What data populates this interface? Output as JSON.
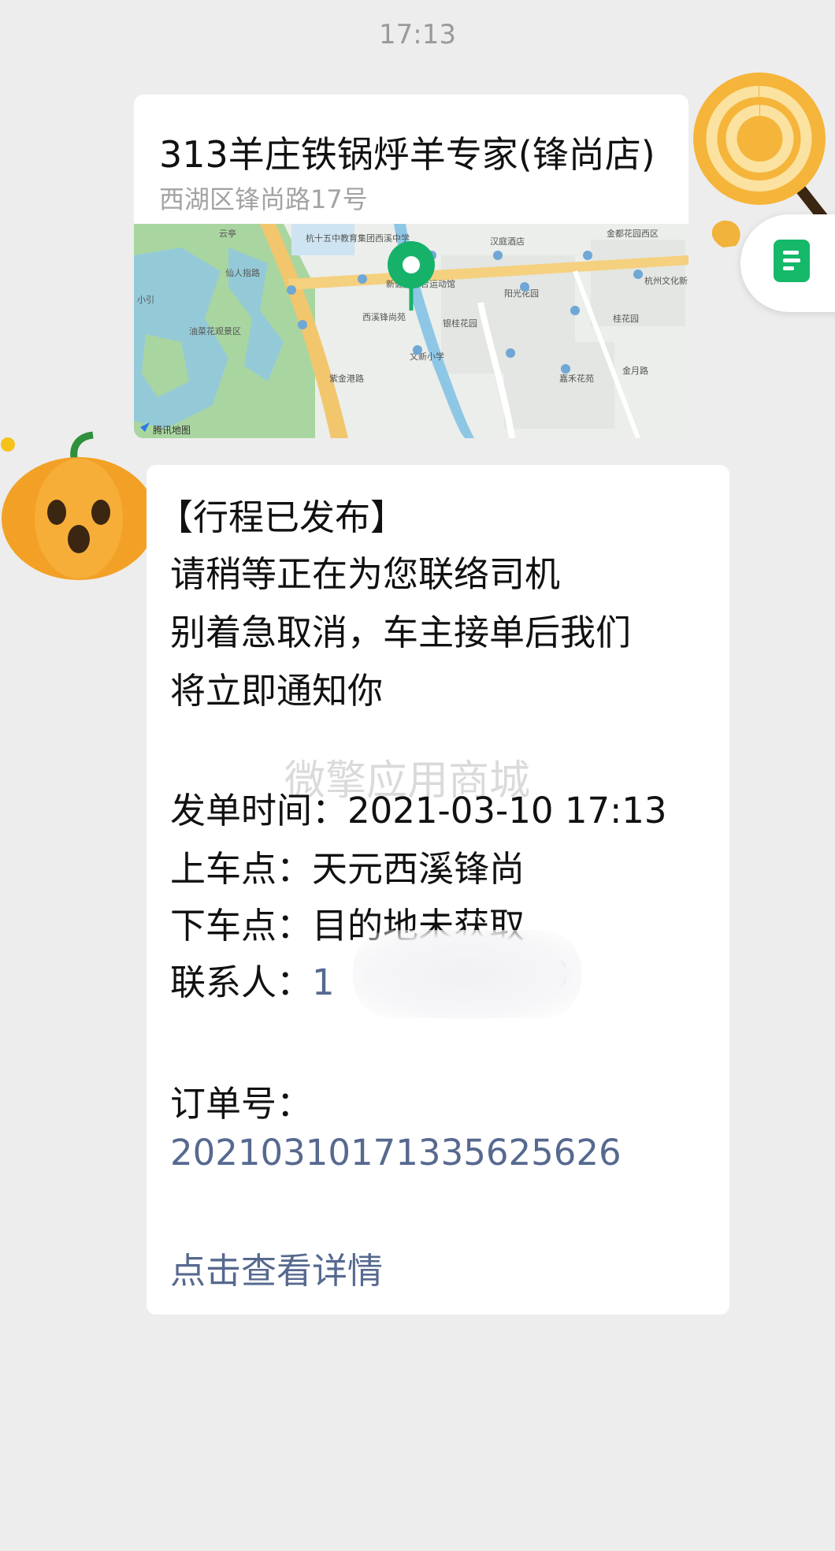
{
  "status_time": "17:13",
  "location_card": {
    "title": "313羊庄铁锅烀羊专家(锋尚店)",
    "address": "西湖区锋尚路17号",
    "map_provider": "腾讯地图",
    "map_labels": [
      "云亭",
      "杭十五中教育集团西溪中学",
      "汉庭酒店",
      "金都花园西区",
      "仙人指路",
      "杭州文化新",
      "小引",
      "新健身综合运动馆",
      "阳光花园",
      "西溪锋尚苑",
      "银桂花园",
      "桂花园",
      "油菜花观景区",
      "文新小学",
      "紫金港路",
      "嘉禾花苑",
      "金月路"
    ]
  },
  "message": {
    "heading": "【行程已发布】",
    "line1": "请稍等正在为您联络司机",
    "line2": "别着急取消，车主接单后我们",
    "line3": "将立即通知你",
    "watermark": "微擎应用商城",
    "order_time_label": "发单时间：",
    "order_time_value": "2021-03-10 17:13",
    "pickup_label": "上车点：",
    "pickup_value": "天元西溪锋尚",
    "dropoff_label": "下车点：",
    "dropoff_value": "目的地未获取",
    "contact_label": "联系人：",
    "contact_value_start": "1",
    "contact_value_end": "3",
    "order_no_label": "订单号：",
    "order_no_value": "20210310171335625626",
    "detail_link": "点击查看详情"
  },
  "colors": {
    "background": "#ededed",
    "link_blue": "#56698f",
    "pin_green": "#17b26a",
    "map_water": "#8ec7e6",
    "map_green": "#a9d6a0",
    "map_road": "#f2c66d"
  },
  "icons": [
    "location-pin-icon",
    "document-icon",
    "tencent-map-logo-icon"
  ]
}
